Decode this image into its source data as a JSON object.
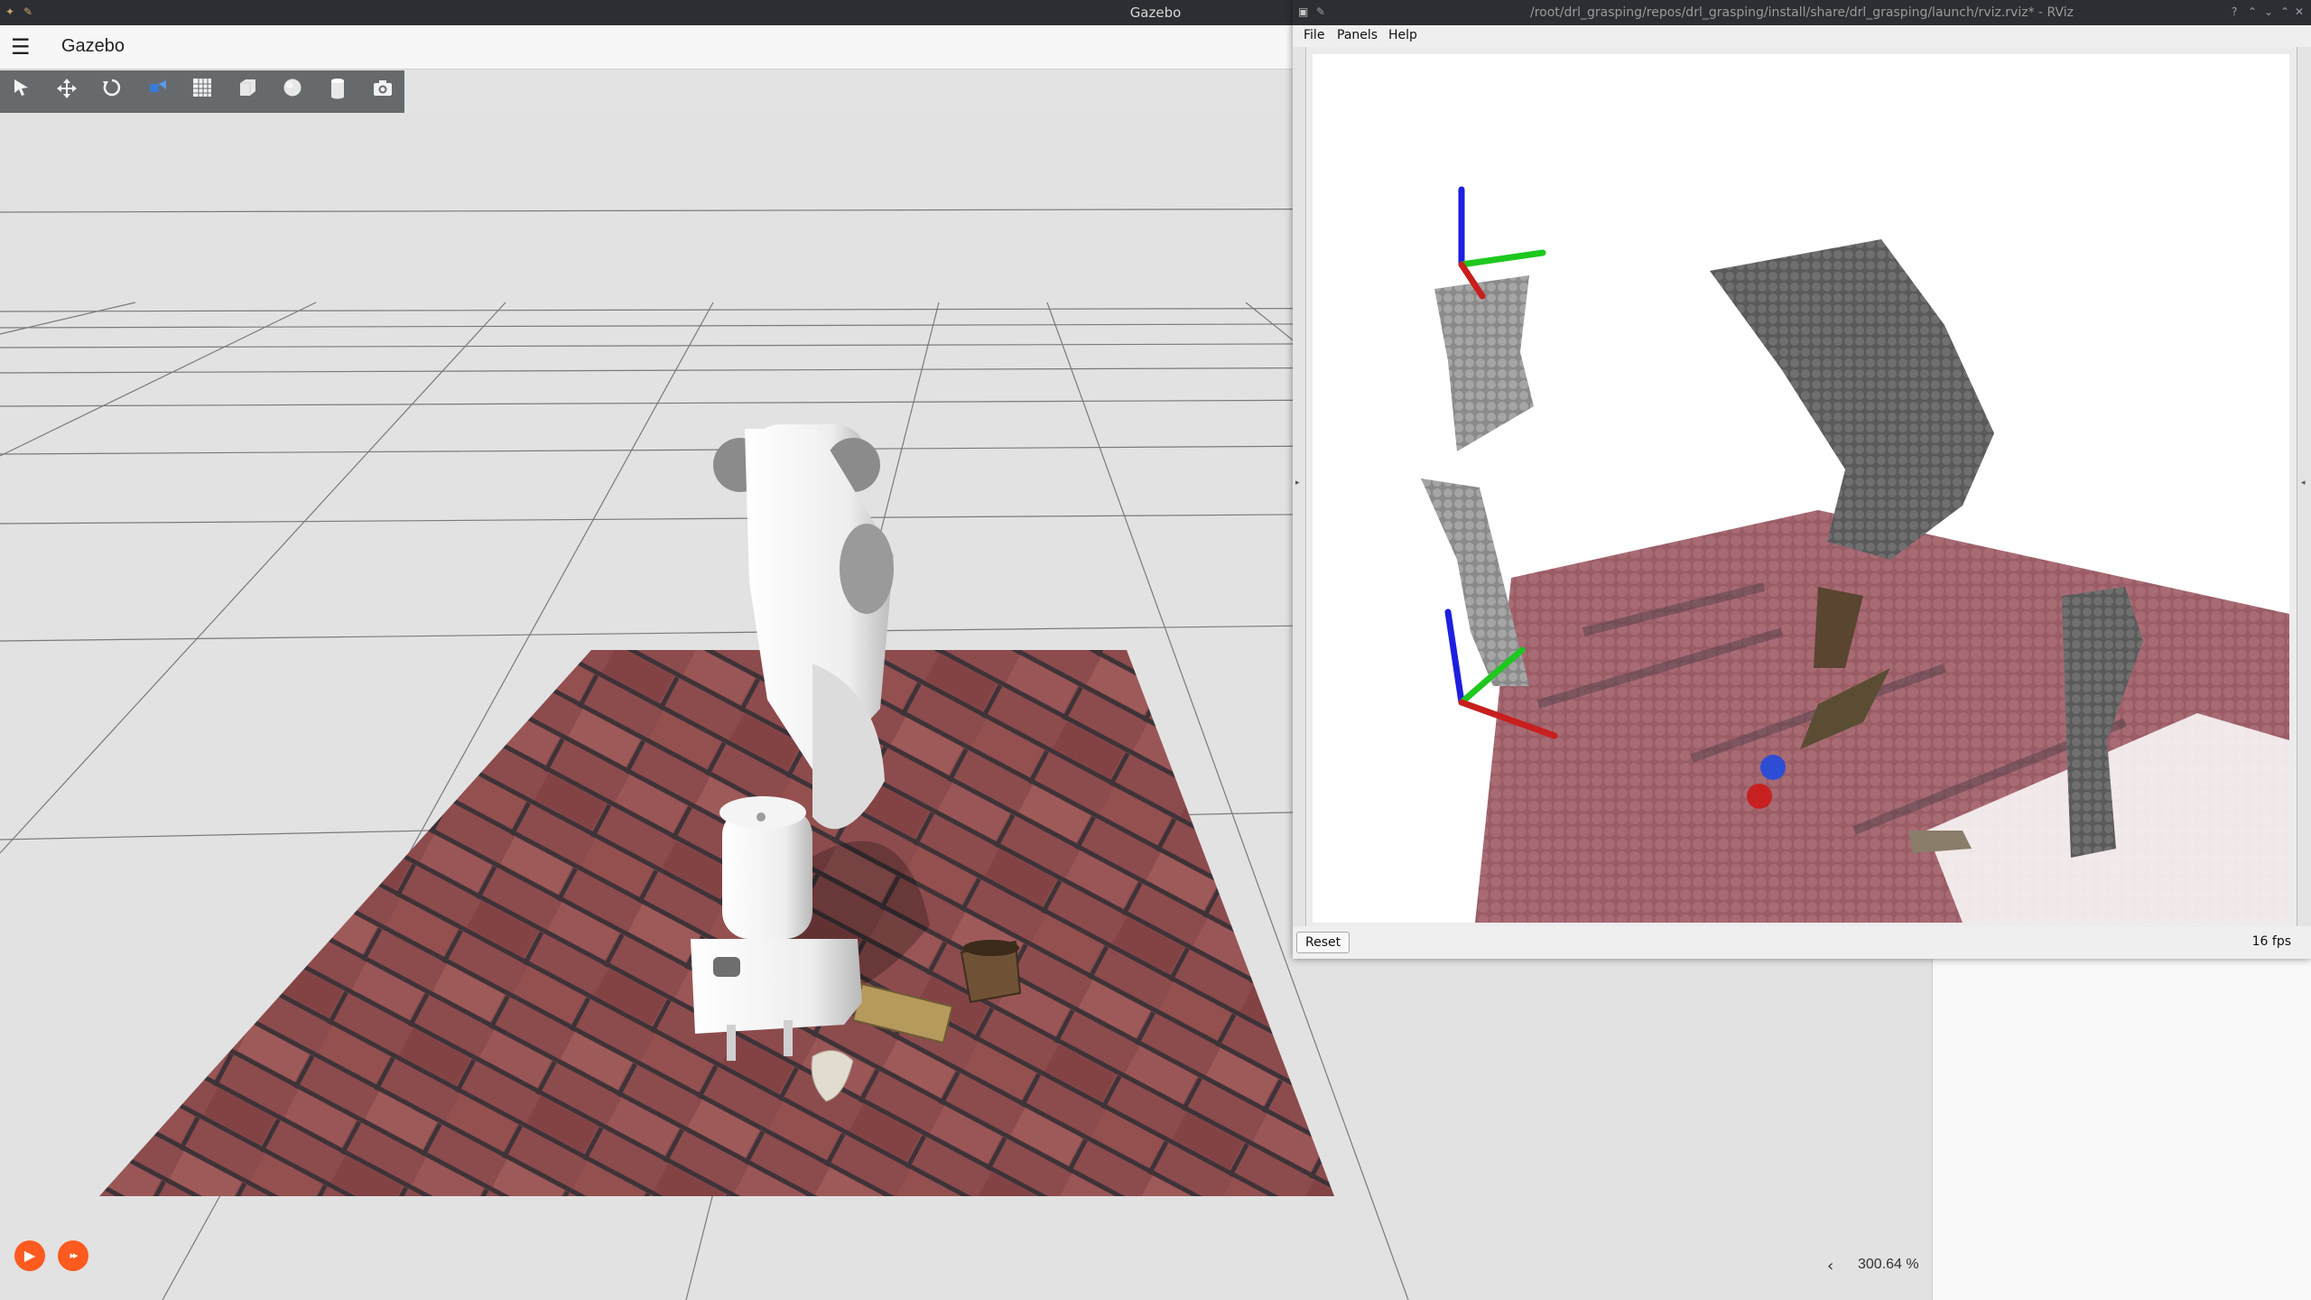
{
  "gazebo": {
    "window_title": "Gazebo",
    "app_title": "Gazebo",
    "toolbar": [
      "select-tool",
      "translate-tool",
      "rotate-tool",
      "scale-tool",
      "grid-toggle",
      "box-shape",
      "sphere-shape",
      "cylinder-shape",
      "screenshot-camera"
    ],
    "zoom_arrow": "‹",
    "zoom_text": "300.64 %",
    "play_icon": "▶",
    "step_icon": "▸▸"
  },
  "rviz": {
    "window_title": "/root/drl_grasping/repos/drl_grasping/install/share/drl_grasping/launch/rviz.rviz* - RViz",
    "menus": [
      {
        "label": "File",
        "mnemonic": "F"
      },
      {
        "label": "Panels",
        "mnemonic": "P"
      },
      {
        "label": "Help",
        "mnemonic": "H"
      }
    ],
    "reset_label": "Reset",
    "fps_text": "16 fps"
  },
  "colors": {
    "accent_orange": "#ff5a1f",
    "titlebar": "#2b2f33",
    "toolbar": "#666a6d",
    "brick": "#8e4a4a",
    "axis_x": "#e01e1e",
    "axis_y": "#1ec81e",
    "axis_z": "#1e1ee0"
  }
}
